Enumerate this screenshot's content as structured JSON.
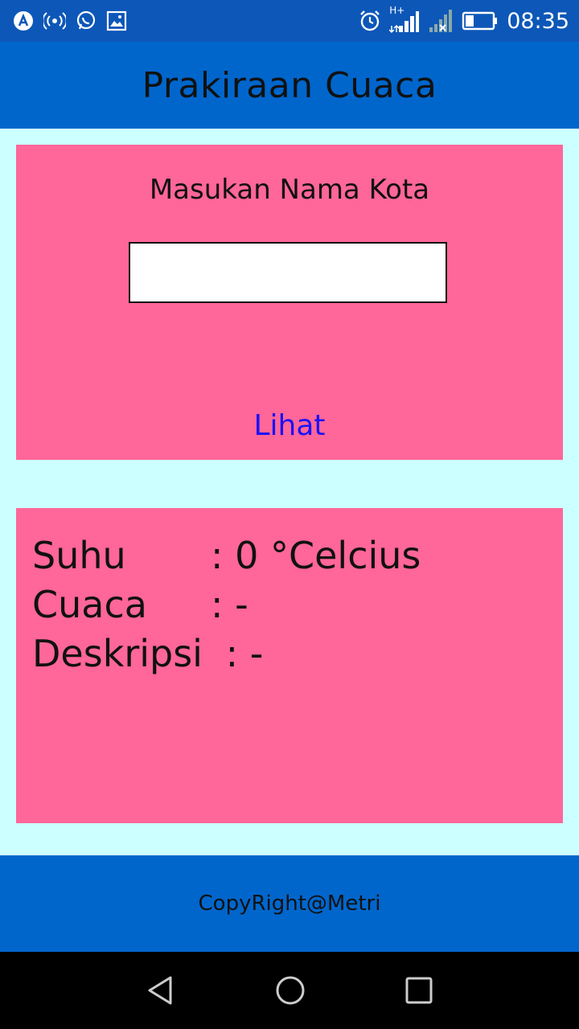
{
  "status_bar": {
    "time": "08:35",
    "network_label": "H+",
    "icons": [
      "android-icon",
      "hotspot-icon",
      "whatsapp-icon",
      "image-icon",
      "alarm-icon",
      "signal-icon",
      "signal-no-sim-icon",
      "battery-icon"
    ]
  },
  "app": {
    "title": "Prakiraan Cuaca"
  },
  "search": {
    "prompt": "Masukan Nama Kota",
    "value": "",
    "placeholder": "",
    "button_label": "Lihat"
  },
  "weather": {
    "suhu_label": "Suhu",
    "suhu_value": ": 0 °Celcius",
    "cuaca_label": "Cuaca",
    "cuaca_value": ": -",
    "deskripsi_label": "Deskripsi",
    "deskripsi_value": ": -"
  },
  "footer": {
    "copyright": "CopyRight@Metri"
  },
  "colors": {
    "status_bar": "#0d57b8",
    "app_bar": "#0066cc",
    "background": "#ccffff",
    "card": "#ff6699",
    "link": "#1a12f5"
  }
}
